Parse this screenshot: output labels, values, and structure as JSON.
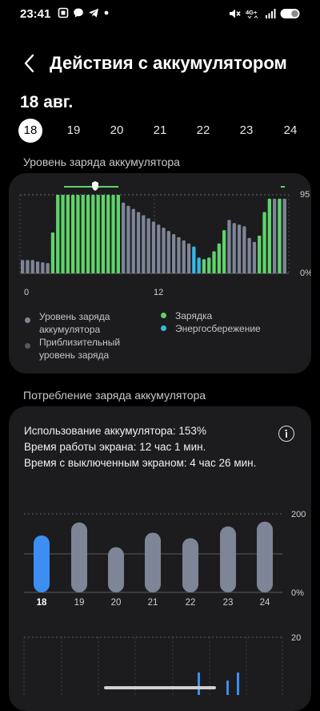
{
  "status_bar": {
    "time": "23:41",
    "left_icons": [
      "screenshot-icon",
      "chat-bubble-icon",
      "telegram-icon",
      "dot-icon"
    ],
    "right_icons": [
      "mute-icon",
      "network-4g-icon",
      "signal-icon",
      "battery-icon"
    ],
    "network": "4G+"
  },
  "header": {
    "title": "Действия с аккумулятором",
    "back_icon": "back-arrow-icon"
  },
  "date_heading": "18 авг.",
  "days": [
    "18",
    "19",
    "20",
    "21",
    "22",
    "23",
    "24"
  ],
  "selected_day": "18",
  "level_section": {
    "label": "Уровень заряда аккумулятора",
    "y_top_label": "95",
    "y_bottom_label": "0%",
    "x_labels": [
      "0",
      "12"
    ],
    "legend": {
      "level": "Уровень заряда аккумулятора",
      "approx": "Приблизительный уровень заряда",
      "charging": "Зарядка",
      "saving": "Энергосбережение"
    },
    "colors": {
      "level": "#7d8596",
      "charging": "#5ed36a",
      "saving": "#35b9e6",
      "approx": "#55585e"
    }
  },
  "chart_data": [
    {
      "type": "bar",
      "title": "Уровень заряда аккумулятора",
      "ylim": [
        0,
        100
      ],
      "note_values": "battery % per ~20-min slot, state: L=level, C=charging, S=saving",
      "values": [
        17,
        17,
        17,
        15,
        14,
        13,
        52,
        100,
        100,
        100,
        100,
        100,
        100,
        100,
        100,
        100,
        100,
        100,
        100,
        100,
        90,
        86,
        82,
        78,
        74,
        70,
        66,
        62,
        58,
        54,
        50,
        46,
        42,
        38,
        34,
        20,
        18,
        20,
        28,
        38,
        55,
        68,
        64,
        62,
        60,
        45,
        40,
        48,
        78,
        95,
        95,
        95,
        95
      ],
      "states": [
        "L",
        "L",
        "L",
        "L",
        "L",
        "L",
        "C",
        "C",
        "C",
        "C",
        "C",
        "C",
        "C",
        "C",
        "C",
        "C",
        "C",
        "C",
        "C",
        "C",
        "L",
        "L",
        "L",
        "L",
        "L",
        "L",
        "L",
        "L",
        "L",
        "L",
        "L",
        "L",
        "L",
        "L",
        "S",
        "S",
        "C",
        "C",
        "C",
        "C",
        "C",
        "L",
        "L",
        "L",
        "L",
        "L",
        "L",
        "C",
        "C",
        "C",
        "L",
        "C",
        "L"
      ]
    },
    {
      "type": "bar",
      "title": "Потребление заряда аккумулятора",
      "categories": [
        "18",
        "19",
        "20",
        "21",
        "22",
        "23",
        "24"
      ],
      "values": [
        145,
        178,
        115,
        152,
        138,
        168,
        180
      ],
      "ylim": [
        0,
        200
      ],
      "y_labels": [
        "200",
        "0%"
      ],
      "selected": "18",
      "colors": {
        "selected": "#3c8ef2",
        "normal": "#7d8596"
      }
    }
  ],
  "consumption_section": {
    "label": "Потребление заряда аккумулятора",
    "usage": "Использование аккумулятора: 153%",
    "screen_on": "Время работы экрана: 12 час 1 мин.",
    "screen_off": "Время с выключенным экраном: 4 час 26 мин.",
    "info_icon": "info-icon",
    "lower_chart_top_label": "20"
  }
}
